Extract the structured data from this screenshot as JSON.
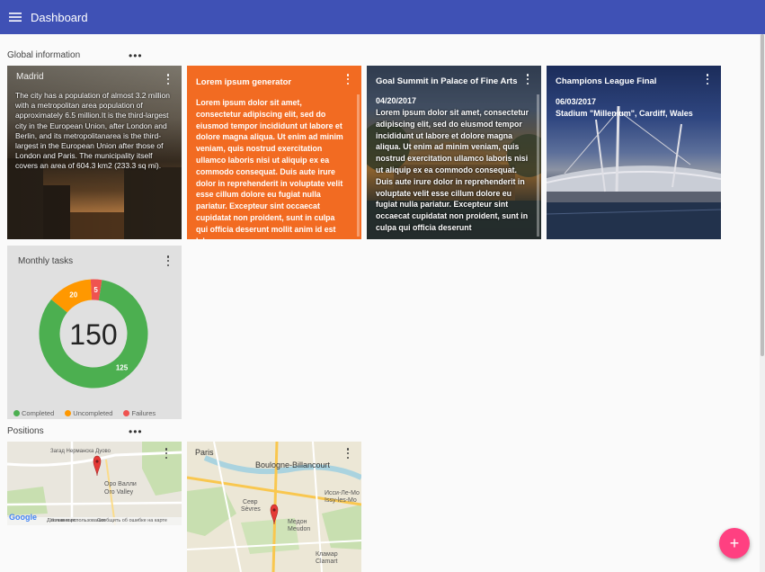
{
  "header": {
    "title": "Dashboard",
    "menu_icon": "hamburger-menu-icon"
  },
  "sections": {
    "global": {
      "title": "Global information",
      "more": "•••"
    },
    "positions": {
      "title": "Positions",
      "more": "•••"
    }
  },
  "cards": {
    "madrid": {
      "title": "Madrid",
      "text": "The city has a population of almost 3.2 million with a metropolitan area population of approximately 6.5 million.It is the third-largest city in the European Union, after London and Berlin, and its metropolitanarea is the third-largest in the European Union after those of London and Paris. The municipality itself covers an area of 604.3 km2 (233.3 sq mi)."
    },
    "lorem": {
      "title": "Lorem ipsum generator",
      "text": "Lorem ipsum dolor sit amet, consectetur adipiscing elit, sed do eiusmod tempor incididunt ut labore et dolore magna aliqua. Ut enim ad minim veniam, quis nostrud exercitation ullamco laboris nisi ut aliquip ex ea commodo consequat. Duis aute irure dolor in reprehenderit in voluptate velit esse cillum dolore eu fugiat nulla pariatur. Excepteur sint occaecat cupidatat non proident, sunt in culpa qui officia deserunt mollit anim id est laborum.",
      "bg_color": "#f26b22"
    },
    "summit": {
      "title": "Goal Summit in Palace of Fine Arts",
      "date": "04/20/2017",
      "text": "Lorem ipsum dolor sit amet, consectetur adipiscing elit, sed do eiusmod tempor incididunt ut labore et dolore magna aliqua. Ut enim ad minim veniam, quis nostrud exercitation ullamco laboris nisi ut aliquip ex ea commodo consequat. Duis aute irure dolor in reprehenderit in voluptate velit esse cillum dolore eu fugiat nulla pariatur. Excepteur sint occaecat cupidatat non proident, sunt in culpa qui officia deserunt"
    },
    "champions": {
      "title": "Champions League Final",
      "date": "06/03/2017",
      "venue": "Stadium \"Millenium\", Cardiff, Wales"
    },
    "tasks": {
      "title": "Monthly tasks",
      "total": "150",
      "legend": [
        {
          "label": "Completed",
          "color": "#4caf50"
        },
        {
          "label": "Uncompleted",
          "color": "#ff9800"
        },
        {
          "label": "Failures",
          "color": "#ef5350"
        }
      ]
    },
    "map_paris": {
      "title": "Paris"
    }
  },
  "chart_data": {
    "type": "pie",
    "title": "Monthly tasks",
    "center_label": "150",
    "slices": [
      {
        "name": "Completed",
        "value": 125,
        "color": "#4caf50"
      },
      {
        "name": "Uncompleted",
        "value": 20,
        "color": "#ff9800"
      },
      {
        "name": "Failures",
        "value": 5,
        "color": "#ef5350"
      }
    ],
    "legend_position": "bottom"
  },
  "map1": {
    "labels": [
      "Загад Нерманска Дуово",
      "Оро Валли",
      "Oro Valley"
    ],
    "footer": [
      "Google",
      "Данные карт",
      "Условия использования",
      "Сообщить об ошибке на карте"
    ]
  },
  "map2": {
    "labels": [
      "Boulogne-Billancourt",
      "Севр",
      "Sèvres",
      "Исси-Ле-Мо",
      "Issy-les-Mo",
      "Медон",
      "Meudon",
      "Кламар",
      "Clamart"
    ]
  },
  "fab": {
    "label": "+"
  }
}
